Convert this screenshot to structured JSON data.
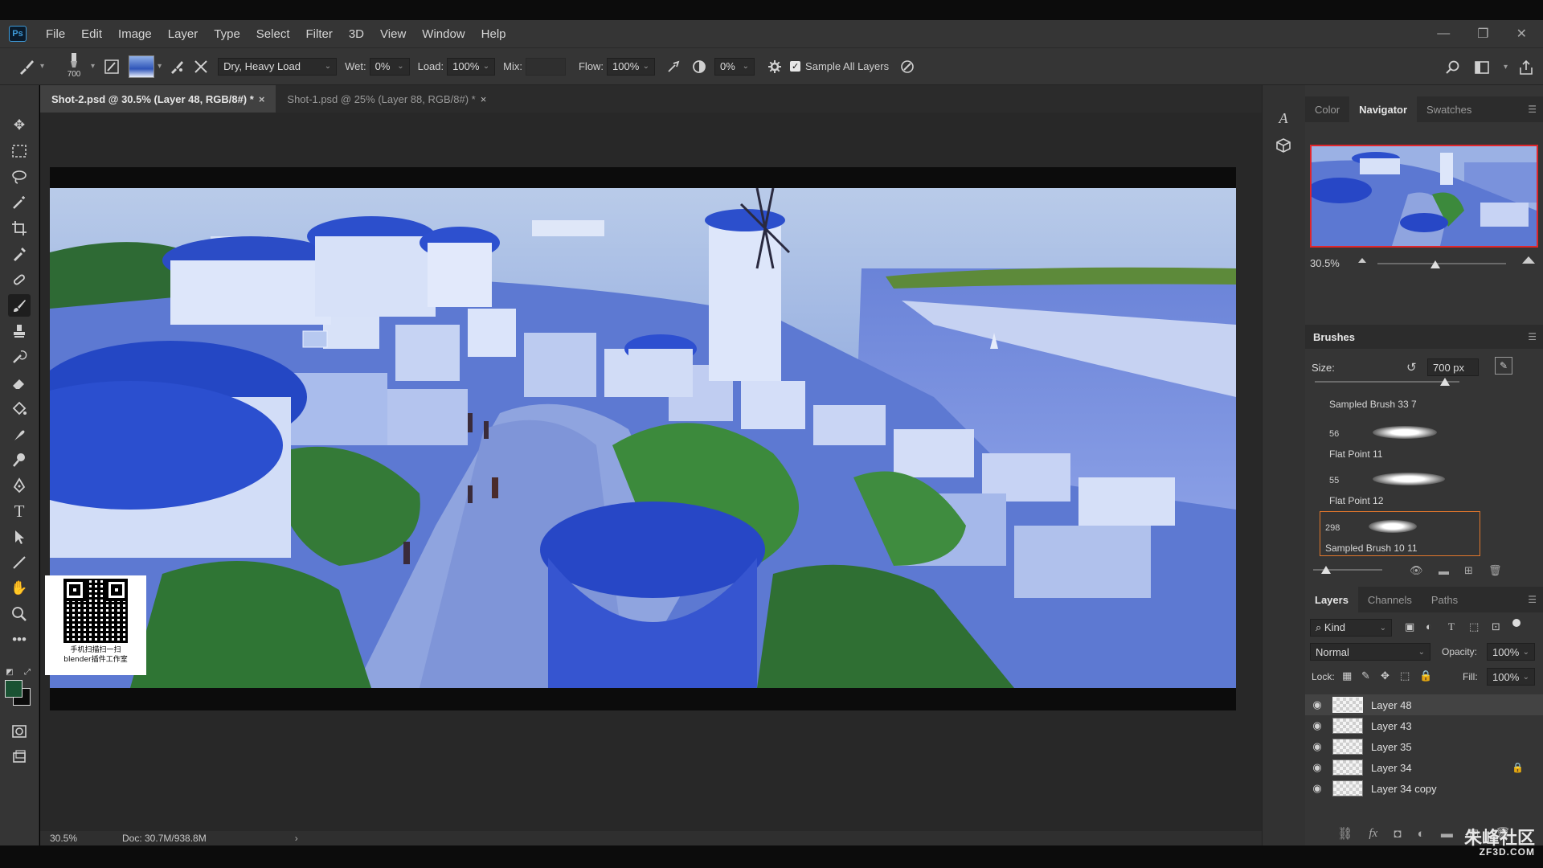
{
  "app": {
    "logo_text": "Ps",
    "menu": [
      "File",
      "Edit",
      "Image",
      "Layer",
      "Type",
      "Select",
      "Filter",
      "3D",
      "View",
      "Window",
      "Help"
    ],
    "window_controls": [
      "—",
      "❐",
      "✕"
    ]
  },
  "options_bar": {
    "brush_size_preview": "700",
    "mode_preset": "Dry, Heavy Load",
    "wet_label": "Wet:",
    "wet_value": "0%",
    "load_label": "Load:",
    "load_value": "100%",
    "mix_label": "Mix:",
    "mix_value": "",
    "flow_label": "Flow:",
    "flow_value": "100%",
    "angle_value": "0%",
    "sample_all_layers_label": "Sample All Layers",
    "sample_all_layers_checked": true
  },
  "documents": {
    "tabs": [
      {
        "label": "Shot-2.psd @ 30.5% (Layer 48, RGB/8#) *",
        "active": true
      },
      {
        "label": "Shot-1.psd @ 25% (Layer 88, RGB/8#) *",
        "active": false
      }
    ],
    "close_glyph": "×"
  },
  "status_bar": {
    "zoom": "30.5%",
    "doc_info": "Doc: 30.7M/938.8M",
    "arrow": "›"
  },
  "watermark_qr": {
    "line1": "手机扫描扫一扫",
    "line2": "blender插件工作室"
  },
  "panels": {
    "top_tabs": [
      "Color",
      "Navigator",
      "Swatches"
    ],
    "top_active": "Navigator",
    "navigator_zoom": "30.5%",
    "navigator_zoom_slider_fraction": 0.45,
    "brushes": {
      "title": "Brushes",
      "size_label": "Size:",
      "size_value": "700 px",
      "size_slider_fraction": 0.9,
      "items": [
        {
          "number": "",
          "name": "Sampled Brush 33 7",
          "selected": false
        },
        {
          "number": "56",
          "name": "Flat Point 11",
          "selected": false
        },
        {
          "number": "55",
          "name": "Flat Point 12",
          "selected": false
        },
        {
          "number": "298",
          "name": "Sampled Brush 10 11",
          "selected": true
        }
      ]
    },
    "layers": {
      "tabs": [
        "Layers",
        "Channels",
        "Paths"
      ],
      "active_tab": "Layers",
      "kind_label": "Kind",
      "blend_mode": "Normal",
      "opacity_label": "Opacity:",
      "opacity_value": "100%",
      "lock_label": "Lock:",
      "fill_label": "Fill:",
      "fill_value": "100%",
      "rows": [
        {
          "name": "Layer 48",
          "selected": true,
          "locked": false
        },
        {
          "name": "Layer 43",
          "selected": false,
          "locked": false
        },
        {
          "name": "Layer 35",
          "selected": false,
          "locked": false
        },
        {
          "name": "Layer 34",
          "selected": false,
          "locked": true
        },
        {
          "name": "Layer 34 copy",
          "selected": false,
          "locked": false
        }
      ]
    }
  },
  "corner_watermark": {
    "title": "朱峰社区",
    "url": "ZF3D.COM"
  },
  "colors": {
    "foreground": "#1a5233",
    "background": "#0b0b0b",
    "accent_selection": "#e0762c",
    "navigator_frame": "#e0262c"
  }
}
